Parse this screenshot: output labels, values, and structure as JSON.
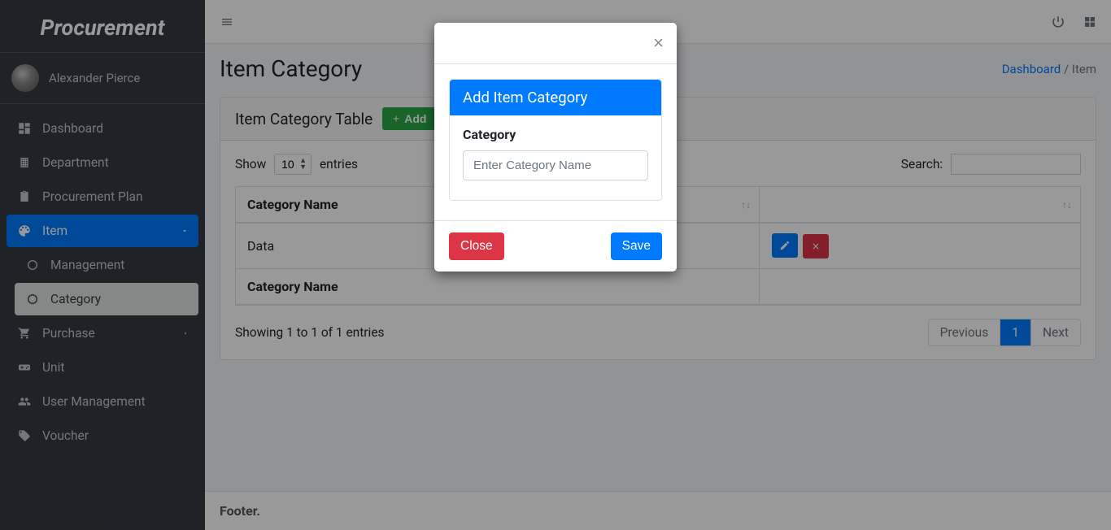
{
  "brand": "Procurement",
  "user": {
    "name": "Alexander Pierce"
  },
  "sidebar": {
    "items": [
      {
        "label": "Dashboard",
        "icon": "dashboard-icon"
      },
      {
        "label": "Department",
        "icon": "building-icon"
      },
      {
        "label": "Procurement Plan",
        "icon": "clipboard-icon"
      },
      {
        "label": "Item",
        "icon": "palette-icon",
        "active": true,
        "caret": true
      },
      {
        "label": "Management",
        "icon": "circle-icon",
        "sub": true
      },
      {
        "label": "Category",
        "icon": "circle-icon",
        "sub": true,
        "subActive": true
      },
      {
        "label": "Purchase",
        "icon": "cart-icon",
        "caret": true
      },
      {
        "label": "Unit",
        "icon": "gamepad-icon"
      },
      {
        "label": "User Management",
        "icon": "users-icon"
      },
      {
        "label": "Voucher",
        "icon": "tag-icon"
      }
    ]
  },
  "header": {
    "title": "Item Category",
    "breadcrumb": {
      "link": "Dashboard",
      "sep": "/",
      "current": "Item"
    }
  },
  "card": {
    "title": "Item Category Table",
    "add_label": "Add"
  },
  "datatable": {
    "show_label": "Show",
    "entries_label": "entries",
    "length_value": "10",
    "search_label": "Search:",
    "columns": [
      "Category Name",
      ""
    ],
    "rows": [
      {
        "name": "Data"
      }
    ],
    "info": "Showing 1 to 1 of 1 entries",
    "prev": "Previous",
    "next": "Next",
    "page": "1"
  },
  "footer": "Footer.",
  "modal": {
    "title": "Add Item Category",
    "field_label": "Category",
    "placeholder": "Enter Category Name",
    "close": "Close",
    "save": "Save"
  }
}
